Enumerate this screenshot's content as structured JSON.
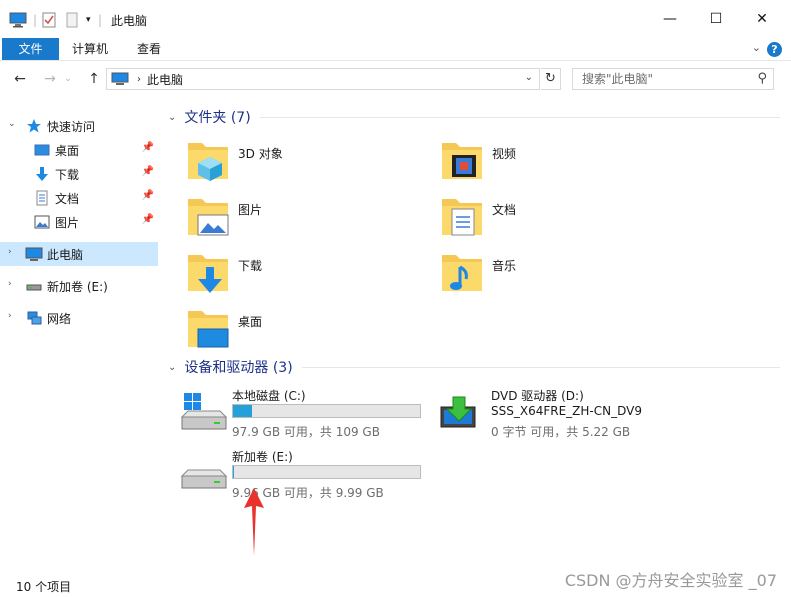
{
  "window": {
    "title": "此电脑",
    "minimize_glyph": "—",
    "maximize_glyph": "☐",
    "close_glyph": "✕"
  },
  "ribbon": {
    "tabs": [
      "文件",
      "计算机",
      "查看"
    ],
    "help": "?"
  },
  "address": {
    "back": "←",
    "forward": "→",
    "up": "↑",
    "breadcrumb": "此电脑",
    "search_placeholder": "搜索\"此电脑\""
  },
  "nav": {
    "quick_access": "快速访问",
    "items": [
      "桌面",
      "下载",
      "文档",
      "图片"
    ],
    "this_pc": "此电脑",
    "new_volume": "新加卷 (E:)",
    "network": "网络"
  },
  "folders": {
    "header": "文件夹 (7)",
    "items": [
      "3D 对象",
      "视频",
      "图片",
      "文档",
      "下载",
      "音乐",
      "桌面"
    ]
  },
  "devices": {
    "header": "设备和驱动器 (3)",
    "local_c": {
      "name": "本地磁盘 (C:)",
      "stat": "97.9 GB 可用，共 109 GB",
      "used_fraction": 0.1
    },
    "dvd_d": {
      "name": "DVD 驱动器 (D:)",
      "label": "SSS_X64FRE_ZH-CN_DV9",
      "stat": "0 字节 可用，共 5.22 GB"
    },
    "new_e": {
      "name": "新加卷 (E:)",
      "stat": "9.96 GB 可用，共 9.99 GB",
      "used_fraction": 0.003
    }
  },
  "status": {
    "count": "10 个项目",
    "watermark": "CSDN @方舟安全实验室 _07"
  },
  "colors": {
    "accent": "#1979ca",
    "selected": "#cce8ff",
    "drive_fill": "#26a0da",
    "header_text": "#1e3287",
    "annotation_arrow": "#e8332d"
  }
}
